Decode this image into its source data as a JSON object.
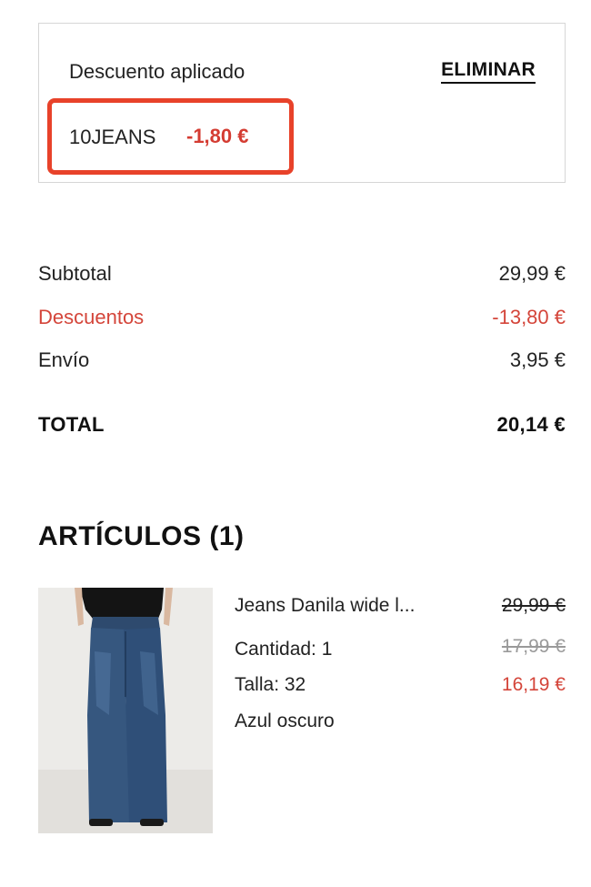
{
  "discount": {
    "title": "Descuento aplicado",
    "remove_label": "ELIMINAR",
    "code": "10JEANS",
    "amount": "-1,80 €",
    "highlight_color": "#e8422a"
  },
  "summary": {
    "subtotal_label": "Subtotal",
    "subtotal_value": "29,99 €",
    "discounts_label": "Descuentos",
    "discounts_value": "-13,80 €",
    "shipping_label": "Envío",
    "shipping_value": "3,95 €",
    "total_label": "TOTAL",
    "total_value": "20,14 €",
    "discount_color": "#d4453a"
  },
  "items": {
    "title": "ARTÍCULOS (1)",
    "list": [
      {
        "name": "Jeans Danila wide l...",
        "quantity": "Cantidad: 1",
        "size": "Talla: 32",
        "color": "Azul oscuro",
        "original_price": "29,99 €",
        "previous_price": "17,99 €",
        "final_price": "16,19 €",
        "image": "dark-blue-wide-leg-jeans-photo"
      }
    ]
  }
}
